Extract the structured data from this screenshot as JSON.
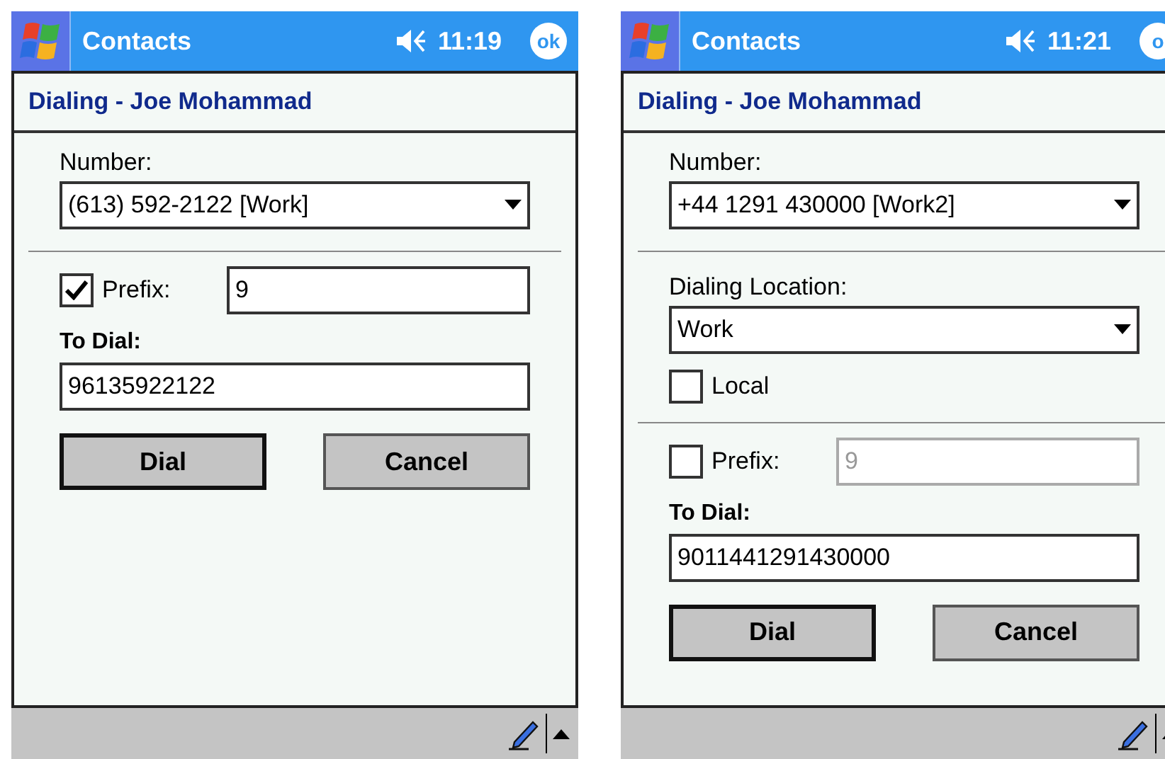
{
  "screens": [
    {
      "title_bar": {
        "app": "Contacts",
        "time": "11:19",
        "ok": "ok"
      },
      "heading": "Dialing - Joe Mohammad",
      "number": {
        "label": "Number:",
        "value": "(613) 592-2122 [Work]"
      },
      "prefix": {
        "label": "Prefix:",
        "checked": true,
        "value": "9",
        "disabled": false
      },
      "to_dial": {
        "label": "To Dial:",
        "value": "96135922122"
      },
      "buttons": [
        {
          "label": "Dial",
          "default": true
        },
        {
          "label": "Cancel",
          "default": false
        }
      ]
    },
    {
      "title_bar": {
        "app": "Contacts",
        "time": "11:21",
        "ok": "o"
      },
      "heading": "Dialing - Joe Mohammad",
      "number": {
        "label": "Number:",
        "value": "+44 1291 430000 [Work2]"
      },
      "location": {
        "label": "Dialing Location:",
        "value": "Work",
        "local": {
          "label": "Local",
          "checked": false
        }
      },
      "prefix": {
        "label": "Prefix:",
        "checked": false,
        "value": "9",
        "disabled": true
      },
      "to_dial": {
        "label": "To Dial:",
        "value": "9011441291430000"
      },
      "buttons": [
        {
          "label": "Dial",
          "default": true
        },
        {
          "label": "Cancel",
          "default": false
        }
      ]
    }
  ]
}
